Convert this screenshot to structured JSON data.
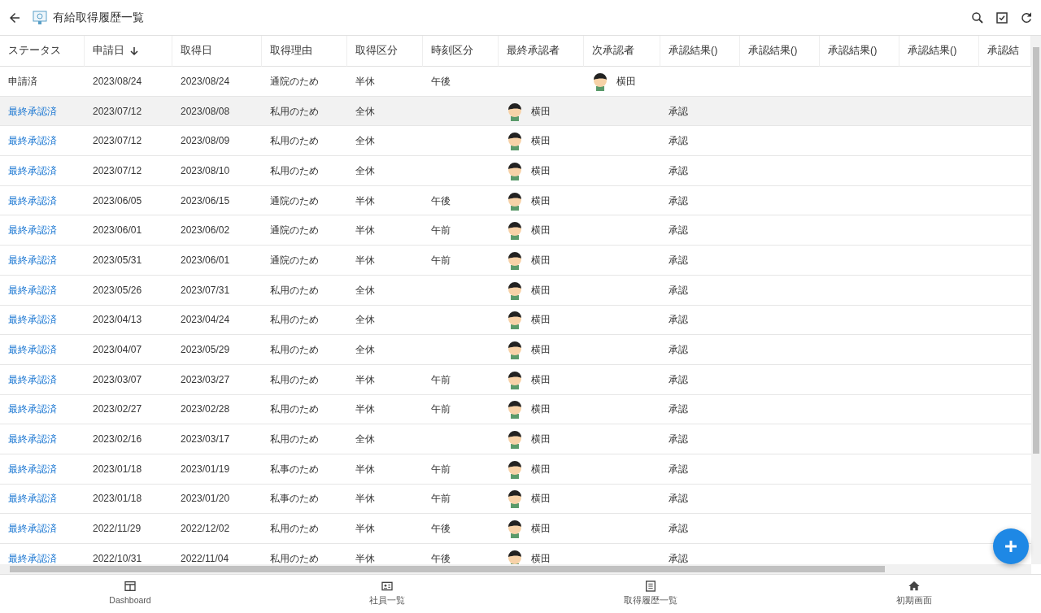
{
  "header": {
    "title": "有給取得履歴一覧"
  },
  "table": {
    "columns": [
      {
        "label": "ステータス",
        "sorted": false
      },
      {
        "label": "申請日",
        "sorted": true
      },
      {
        "label": "取得日",
        "sorted": false
      },
      {
        "label": "取得理由",
        "sorted": false
      },
      {
        "label": "取得区分",
        "sorted": false
      },
      {
        "label": "時刻区分",
        "sorted": false
      },
      {
        "label": "最終承認者",
        "sorted": false
      },
      {
        "label": "次承認者",
        "sorted": false
      },
      {
        "label": "承認結果()",
        "sorted": false
      },
      {
        "label": "承認結果()",
        "sorted": false
      },
      {
        "label": "承認結果()",
        "sorted": false
      },
      {
        "label": "承認結果()",
        "sorted": false
      },
      {
        "label": "承認結",
        "sorted": false
      }
    ],
    "rows": [
      {
        "kind": "plain",
        "selected": false,
        "cells": [
          "申請済",
          "2023/08/24",
          "2023/08/24",
          "通院のため",
          "半休",
          "午後",
          "",
          "横田",
          ""
        ]
      },
      {
        "kind": "link",
        "selected": true,
        "cells": [
          "最終承認済",
          "2023/07/12",
          "2023/08/08",
          "私用のため",
          "全休",
          "",
          "横田",
          "",
          "承認"
        ]
      },
      {
        "kind": "link",
        "selected": false,
        "cells": [
          "最終承認済",
          "2023/07/12",
          "2023/08/09",
          "私用のため",
          "全休",
          "",
          "横田",
          "",
          "承認"
        ]
      },
      {
        "kind": "link",
        "selected": false,
        "cells": [
          "最終承認済",
          "2023/07/12",
          "2023/08/10",
          "私用のため",
          "全休",
          "",
          "横田",
          "",
          "承認"
        ]
      },
      {
        "kind": "link",
        "selected": false,
        "cells": [
          "最終承認済",
          "2023/06/05",
          "2023/06/15",
          "通院のため",
          "半休",
          "午後",
          "横田",
          "",
          "承認"
        ]
      },
      {
        "kind": "link",
        "selected": false,
        "cells": [
          "最終承認済",
          "2023/06/01",
          "2023/06/02",
          "通院のため",
          "半休",
          "午前",
          "横田",
          "",
          "承認"
        ]
      },
      {
        "kind": "link",
        "selected": false,
        "cells": [
          "最終承認済",
          "2023/05/31",
          "2023/06/01",
          "通院のため",
          "半休",
          "午前",
          "横田",
          "",
          "承認"
        ]
      },
      {
        "kind": "link",
        "selected": false,
        "cells": [
          "最終承認済",
          "2023/05/26",
          "2023/07/31",
          "私用のため",
          "全休",
          "",
          "横田",
          "",
          "承認"
        ]
      },
      {
        "kind": "link",
        "selected": false,
        "cells": [
          "最終承認済",
          "2023/04/13",
          "2023/04/24",
          "私用のため",
          "全休",
          "",
          "横田",
          "",
          "承認"
        ]
      },
      {
        "kind": "link",
        "selected": false,
        "cells": [
          "最終承認済",
          "2023/04/07",
          "2023/05/29",
          "私用のため",
          "全休",
          "",
          "横田",
          "",
          "承認"
        ]
      },
      {
        "kind": "link",
        "selected": false,
        "cells": [
          "最終承認済",
          "2023/03/07",
          "2023/03/27",
          "私用のため",
          "半休",
          "午前",
          "横田",
          "",
          "承認"
        ]
      },
      {
        "kind": "link",
        "selected": false,
        "cells": [
          "最終承認済",
          "2023/02/27",
          "2023/02/28",
          "私用のため",
          "半休",
          "午前",
          "横田",
          "",
          "承認"
        ]
      },
      {
        "kind": "link",
        "selected": false,
        "cells": [
          "最終承認済",
          "2023/02/16",
          "2023/03/17",
          "私用のため",
          "全休",
          "",
          "横田",
          "",
          "承認"
        ]
      },
      {
        "kind": "link",
        "selected": false,
        "cells": [
          "最終承認済",
          "2023/01/18",
          "2023/01/19",
          "私事のため",
          "半休",
          "午前",
          "横田",
          "",
          "承認"
        ]
      },
      {
        "kind": "link",
        "selected": false,
        "cells": [
          "最終承認済",
          "2023/01/18",
          "2023/01/20",
          "私事のため",
          "半休",
          "午前",
          "横田",
          "",
          "承認"
        ]
      },
      {
        "kind": "link",
        "selected": false,
        "cells": [
          "最終承認済",
          "2022/11/29",
          "2022/12/02",
          "私用のため",
          "半休",
          "午後",
          "横田",
          "",
          "承認"
        ]
      },
      {
        "kind": "link",
        "selected": false,
        "cells": [
          "最終承認済",
          "2022/10/31",
          "2022/11/04",
          "私用のため",
          "半休",
          "午後",
          "横田",
          "",
          "承認"
        ]
      }
    ]
  },
  "bottom_nav": [
    {
      "label": "Dashboard"
    },
    {
      "label": "社員一覧"
    },
    {
      "label": "取得履歴一覧"
    },
    {
      "label": "初期画面"
    }
  ]
}
